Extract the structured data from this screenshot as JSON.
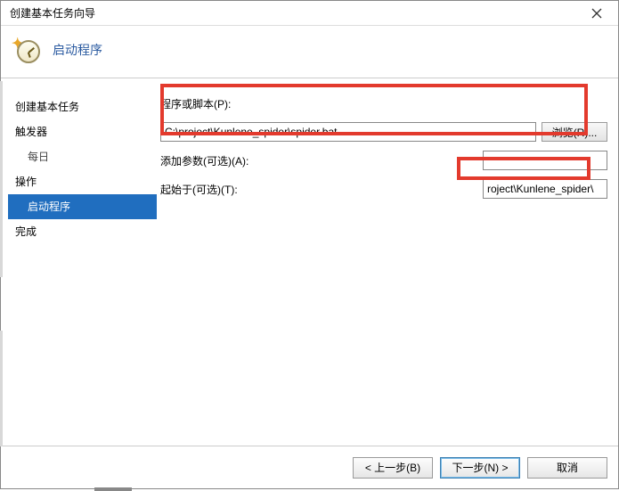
{
  "window": {
    "title": "创建基本任务向导"
  },
  "header": {
    "title": "启动程序"
  },
  "sidebar": {
    "items": [
      {
        "label": "创建基本任务",
        "indent": false
      },
      {
        "label": "触发器",
        "indent": false
      },
      {
        "label": "每日",
        "indent": true
      },
      {
        "label": "操作",
        "indent": false
      },
      {
        "label": "启动程序",
        "indent": true,
        "selected": true
      },
      {
        "label": "完成",
        "indent": false
      }
    ]
  },
  "form": {
    "script_label": "程序或脚本(P):",
    "script_value": "C:\\project\\Kunlene_spider\\spider.bat",
    "browse_label": "浏览(R)...",
    "args_label": "添加参数(可选)(A):",
    "args_value": "",
    "startin_label": "起始于(可选)(T):",
    "startin_value": "roject\\Kunlene_spider\\"
  },
  "footer": {
    "back": "< 上一步(B)",
    "next": "下一步(N) >",
    "cancel": "取消"
  }
}
